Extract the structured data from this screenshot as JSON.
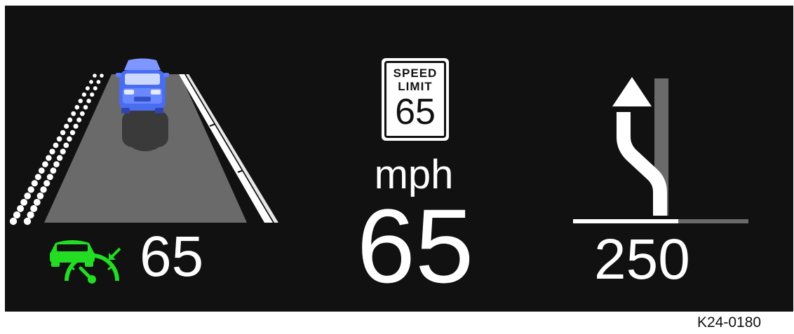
{
  "screen": {
    "background": "#111111",
    "reference_code": "K24-0180"
  },
  "lane_assist": {
    "vehicle_icon": "car-front-view-icon",
    "vehicle_color": "#5b7cff",
    "road_color": "#6a6a6a",
    "lane_line_left_style": "dotted",
    "lane_line_right_style": "dashed"
  },
  "adaptive_cruise": {
    "icon": "acc-car-speedometer-icon",
    "icon_color": "#22dd22",
    "set_speed": "65"
  },
  "speed_limit_sign": {
    "line1": "SPEED",
    "line2": "LIMIT",
    "value": "65"
  },
  "speedometer": {
    "unit": "mph",
    "current_speed": "65"
  },
  "navigation": {
    "maneuver_icon": "keep-left-lane-arrow-icon",
    "distance": "250",
    "progress_fraction": 0.6
  }
}
